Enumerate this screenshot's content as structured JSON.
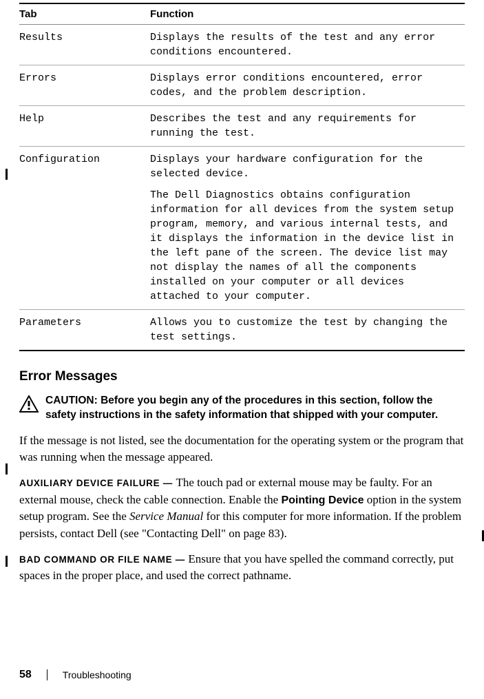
{
  "table": {
    "headers": {
      "tab": "Tab",
      "function": "Function"
    },
    "rows": [
      {
        "tab": "Results",
        "function": "Displays the results of the test and any error conditions encountered."
      },
      {
        "tab": "Errors",
        "function": "Displays error conditions encountered, error codes, and the problem description."
      },
      {
        "tab": "Help",
        "function": "Describes the test and any requirements for running the test."
      },
      {
        "tab": "Configuration",
        "function_p1": "Displays your hardware configuration for the selected device.",
        "function_p2": "The Dell Diagnostics obtains configuration information for all devices from the system setup program, memory, and various internal tests, and it displays the information in the device list in the left pane of the screen. The device list may not display the names of all the components installed on your computer or all devices attached to your computer."
      },
      {
        "tab": "Parameters",
        "function": "Allows you to customize the test by changing the test settings."
      }
    ]
  },
  "section_heading": "Error Messages",
  "caution": {
    "label": "CAUTION: ",
    "text": "Before you begin any of the procedures in this section, follow the safety instructions in the safety information that shipped with your computer."
  },
  "intro_para": "If the message is not listed, see the documentation for the operating system or the program that was running when the message appeared.",
  "messages": [
    {
      "label": "AUXILIARY DEVICE FAILURE — ",
      "text_before_bold": "The touch pad or external mouse may be faulty. For an external mouse, check the cable connection. Enable the ",
      "bold": "Pointing Device",
      "text_after_bold": " option in the system setup program. See the ",
      "italic": "Service Manual",
      "text_after_italic": " for this computer for more information. If the problem persists, contact Dell (see \"Contacting Dell\" on page 83)."
    },
    {
      "label": "BAD COMMAND OR FILE NAME — ",
      "text": "Ensure that you have spelled the command correctly, put spaces in the proper place, and used the correct pathname."
    }
  ],
  "footer": {
    "page": "58",
    "section": "Troubleshooting"
  }
}
